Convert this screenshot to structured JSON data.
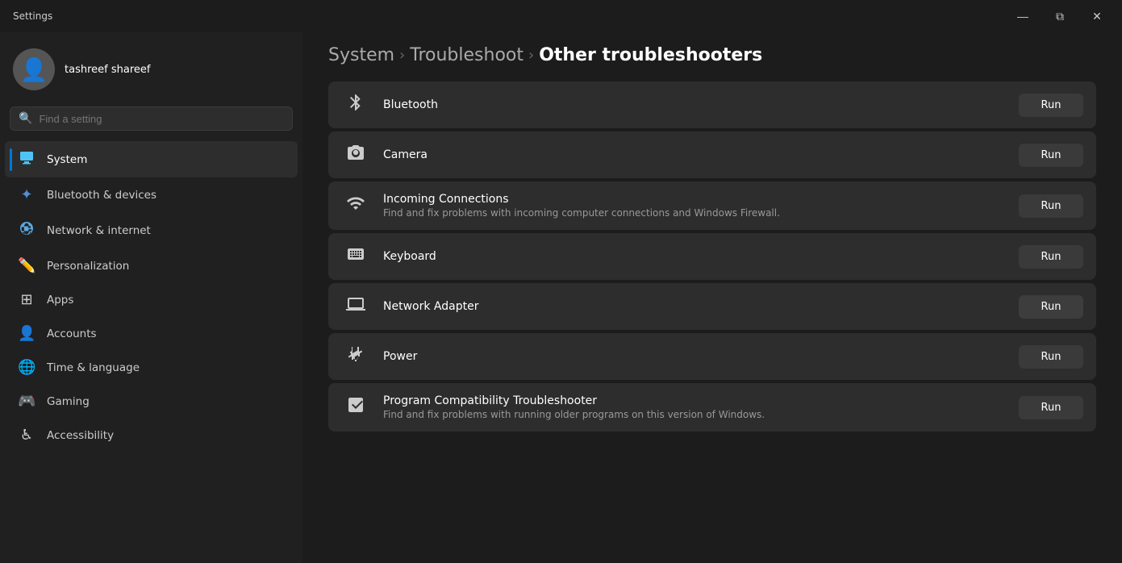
{
  "titleBar": {
    "title": "Settings",
    "minimize": "—",
    "maximize": "⧉",
    "close": "✕"
  },
  "sidebar": {
    "user": {
      "name": "tashreef shareef"
    },
    "search": {
      "placeholder": "Find a setting"
    },
    "navItems": [
      {
        "id": "system",
        "label": "System",
        "icon": "system",
        "active": true
      },
      {
        "id": "bluetooth",
        "label": "Bluetooth & devices",
        "icon": "bluetooth"
      },
      {
        "id": "network",
        "label": "Network & internet",
        "icon": "network"
      },
      {
        "id": "personalization",
        "label": "Personalization",
        "icon": "personalization"
      },
      {
        "id": "apps",
        "label": "Apps",
        "icon": "apps"
      },
      {
        "id": "accounts",
        "label": "Accounts",
        "icon": "accounts"
      },
      {
        "id": "time",
        "label": "Time & language",
        "icon": "time"
      },
      {
        "id": "gaming",
        "label": "Gaming",
        "icon": "gaming"
      },
      {
        "id": "accessibility",
        "label": "Accessibility",
        "icon": "accessibility"
      }
    ]
  },
  "breadcrumb": {
    "items": [
      {
        "label": "System",
        "current": false
      },
      {
        "label": "Troubleshoot",
        "current": false
      },
      {
        "label": "Other troubleshooters",
        "current": true
      }
    ]
  },
  "troubleshooters": [
    {
      "id": "bluetooth",
      "icon": "bluetooth",
      "title": "Bluetooth",
      "description": "",
      "runLabel": "Run"
    },
    {
      "id": "camera",
      "icon": "camera",
      "title": "Camera",
      "description": "",
      "runLabel": "Run"
    },
    {
      "id": "incoming-connections",
      "icon": "incoming-connections",
      "title": "Incoming Connections",
      "description": "Find and fix problems with incoming computer connections and Windows Firewall.",
      "runLabel": "Run"
    },
    {
      "id": "keyboard",
      "icon": "keyboard",
      "title": "Keyboard",
      "description": "",
      "runLabel": "Run"
    },
    {
      "id": "network-adapter",
      "icon": "network-adapter",
      "title": "Network Adapter",
      "description": "",
      "runLabel": "Run"
    },
    {
      "id": "power",
      "icon": "power",
      "title": "Power",
      "description": "",
      "runLabel": "Run"
    },
    {
      "id": "program-compatibility",
      "icon": "program-compatibility",
      "title": "Program Compatibility Troubleshooter",
      "description": "Find and fix problems with running older programs on this version of Windows.",
      "runLabel": "Run"
    }
  ]
}
